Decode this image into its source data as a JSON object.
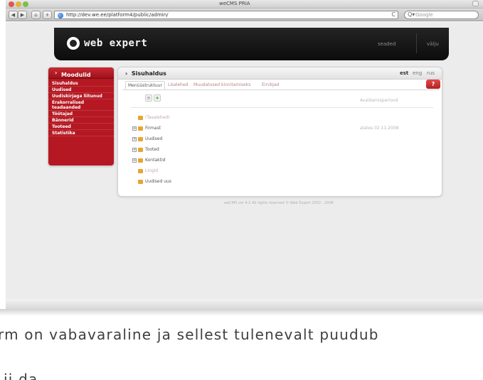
{
  "browser": {
    "window_title": "weCMS PRIA",
    "nav_back": "◀",
    "nav_forward": "▶",
    "home_label": "⌂",
    "add_label": "+",
    "url": "http://dev.we.ee/platform4/public/admin/",
    "reload_label": "C",
    "search_icon_label": "Q▾",
    "search_placeholder": "Google"
  },
  "brand": {
    "name": "web expert",
    "links": [
      "seaded",
      "välju"
    ]
  },
  "left_menu": {
    "title": "Moodulid",
    "items": [
      "Sisuhaldus",
      "Uudised",
      "Uudiskirjaga liitunud",
      "Erakorralised teadaanded",
      "Töötajad",
      "Bännerid",
      "Tooteed",
      "Statistika"
    ]
  },
  "main": {
    "title": "Sisuhaldus",
    "languages": [
      "est",
      "eng",
      "rus"
    ],
    "tabs": [
      "Menüüstruktuur",
      "Lisalehed",
      "Muudatused kinnitamiseks",
      "Eirvbjad"
    ],
    "help_label": "?",
    "column_header": "Avaldamisperiood",
    "tree": [
      {
        "label": "(Tasalehed)",
        "dim": true,
        "expander": "",
        "meta": ""
      },
      {
        "label": "Firmast",
        "dim": false,
        "expander": "+",
        "meta": "alates 02.11.2008"
      },
      {
        "label": "Uudised",
        "dim": false,
        "expander": "+",
        "meta": ""
      },
      {
        "label": "Tooted",
        "dim": false,
        "expander": "+",
        "meta": ""
      },
      {
        "label": "Kontaktid",
        "dim": false,
        "expander": "+",
        "meta": ""
      },
      {
        "label": "Lingid",
        "dim": true,
        "expander": "",
        "meta": ""
      },
      {
        "label": "Uudised uus",
        "dim": false,
        "expander": "",
        "meta": ""
      }
    ]
  },
  "footer": "weCMS ver 4.2 All rights reserved © Web Expert 2002 - 2008",
  "caption_line1": "rm on vabavaraline ja sellest tulenevalt puudub",
  "caption_line2": "ij da",
  "colors": {
    "menu_red": "#b51822",
    "help_red": "#c52a2a",
    "header_black": "#121212",
    "folder": "#e7a531"
  }
}
